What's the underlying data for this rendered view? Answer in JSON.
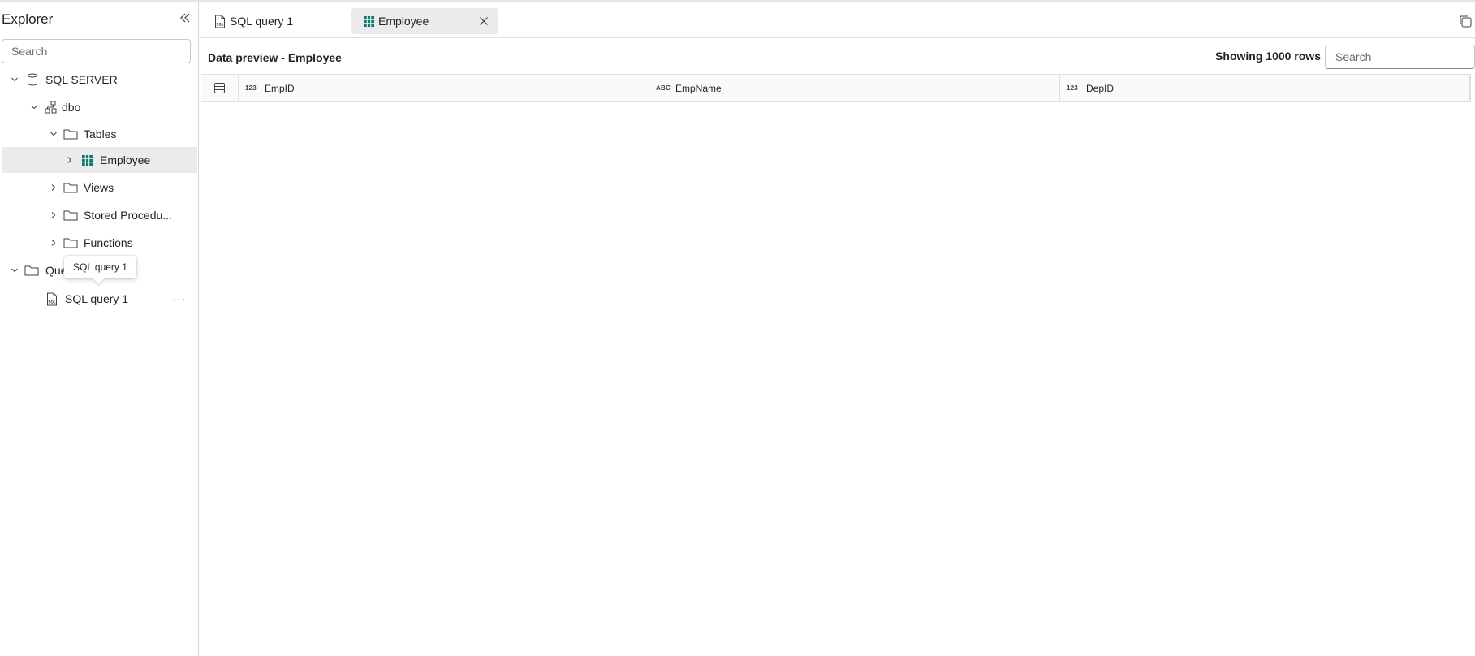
{
  "sidebar": {
    "title": "Explorer",
    "search_placeholder": "Search",
    "tree": {
      "server": "SQL SERVER",
      "schema": "dbo",
      "tables_folder": "Tables",
      "employee_table": "Employee",
      "views_folder": "Views",
      "procedures_folder": "Stored Procedu...",
      "functions_folder": "Functions",
      "queries_folder": "Que",
      "query_item": "SQL query 1",
      "more_label": "···"
    },
    "tooltip": "SQL query 1"
  },
  "tabs": [
    {
      "label": "SQL query 1",
      "icon": "sql-file-icon",
      "active": false
    },
    {
      "label": "Employee",
      "icon": "table-icon",
      "active": true
    }
  ],
  "preview": {
    "title": "Data preview - Employee",
    "rows_label": "Showing 1000 rows",
    "search_placeholder": "Search",
    "columns": [
      {
        "type": "123",
        "name": "EmpID"
      },
      {
        "type": "ABC",
        "name": "EmpName"
      },
      {
        "type": "123",
        "name": "DepID"
      }
    ]
  },
  "colors": {
    "accent_table": "#0e7a6b",
    "selected_bg": "#ebebeb"
  }
}
